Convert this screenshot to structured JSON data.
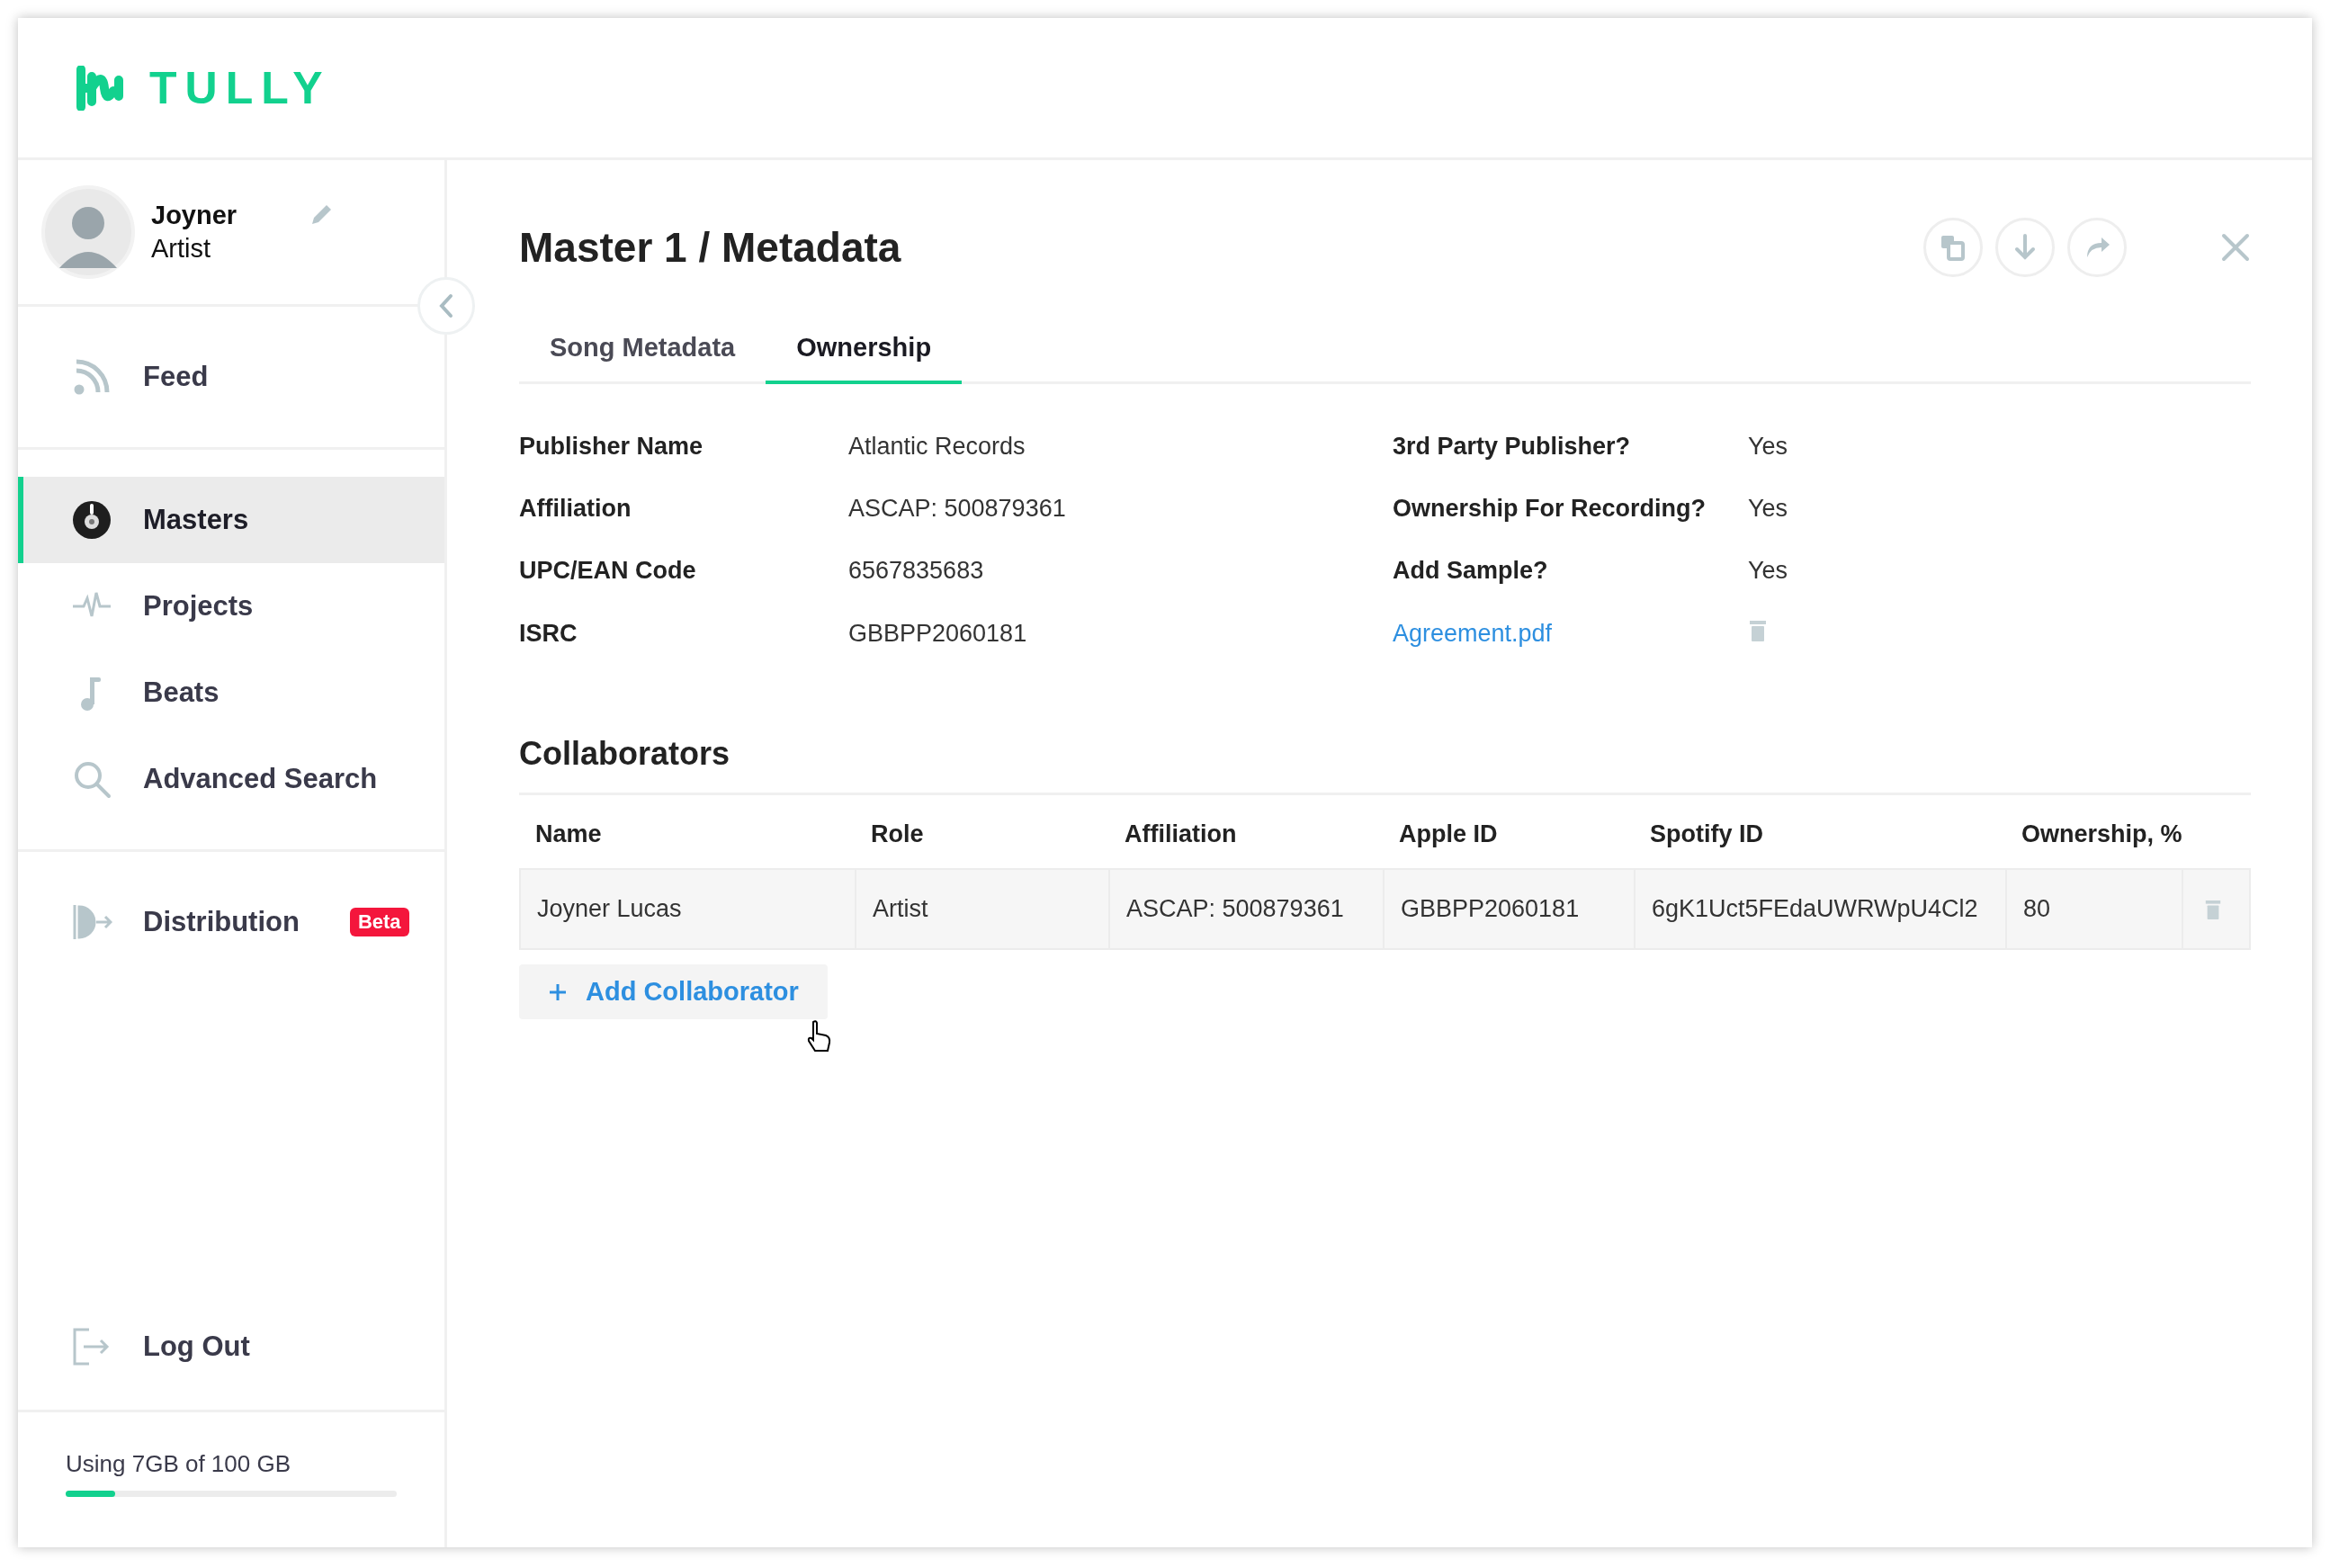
{
  "brand": {
    "name": "TULLY"
  },
  "profile": {
    "name": "Joyner",
    "role": "Artist"
  },
  "nav_groups": [
    [
      {
        "label": "Feed",
        "kind": "feed",
        "selected": false
      }
    ],
    [
      {
        "label": "Masters",
        "kind": "masters",
        "selected": true
      },
      {
        "label": "Projects",
        "kind": "projects",
        "selected": false
      },
      {
        "label": "Beats",
        "kind": "beats",
        "selected": false
      },
      {
        "label": "Advanced Search",
        "kind": "search",
        "selected": false
      }
    ],
    [
      {
        "label": "Distribution",
        "kind": "distribution",
        "selected": false,
        "badge": "Beta"
      }
    ]
  ],
  "logout": {
    "label": "Log Out"
  },
  "storage": {
    "text": "Using 7GB of 100 GB",
    "level": 0.15
  },
  "title": "Master 1 / Metadata",
  "tabs": [
    {
      "label": "Song Metadata",
      "selected": false
    },
    {
      "label": "Ownership",
      "selected": true
    }
  ],
  "fields_left": [
    {
      "label": "Publisher Name",
      "value": "Atlantic Records"
    },
    {
      "label": "Affiliation",
      "value": "ASCAP: 500879361"
    },
    {
      "label": "UPC/EAN Code",
      "value": "6567835683"
    },
    {
      "label": "ISRC",
      "value": "GBBPP2060181"
    }
  ],
  "fields_right": [
    {
      "kind": "field",
      "label": "3rd Party Publisher?",
      "value": "Yes"
    },
    {
      "kind": "field",
      "label": "Ownership For Recording?",
      "value": "Yes"
    },
    {
      "kind": "field",
      "label": "Add Sample?",
      "value": "Yes"
    },
    {
      "kind": "file",
      "name": "Agreement.pdf"
    }
  ],
  "collaborators": {
    "heading": "Collaborators",
    "columns": [
      "Name",
      "Role",
      "Affiliation",
      "Apple ID",
      "Spotify ID",
      "Ownership, %"
    ],
    "rows": [
      [
        "Joyner Lucas",
        "Artist",
        "ASCAP: 500879361",
        "GBBPP2060181",
        "6gK1Uct5FEdaUWRWpU4Cl2",
        "80"
      ]
    ],
    "add_button": "Add Collaborator"
  }
}
